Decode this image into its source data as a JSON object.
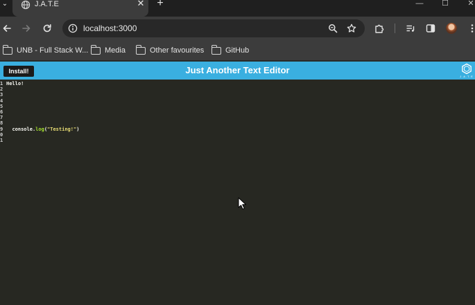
{
  "browser": {
    "tab": {
      "title": "J.A.T.E",
      "close_glyph": "✕"
    },
    "new_tab_glyph": "+",
    "tab_menu_glyph": "⌄",
    "window_controls": [
      "—",
      "☐",
      "✕"
    ],
    "address": {
      "url": "localhost:3000"
    },
    "bookmarks": [
      {
        "label": "UNB - Full Stack W..."
      },
      {
        "label": "Media"
      },
      {
        "label": "Other favourites"
      },
      {
        "label": "GitHub"
      }
    ],
    "icons": {
      "back": "arrow-left-icon",
      "forward": "arrow-right-icon",
      "reload": "reload-icon",
      "info": "info-icon",
      "zoom": "zoom-icon",
      "star": "star-icon",
      "extensions": "puzzle-icon",
      "media": "media-control-icon",
      "side_panel": "side-panel-icon",
      "menu": "kebab-menu-icon"
    }
  },
  "app": {
    "install_label": "Install!",
    "title": "Just Another Text Editor",
    "logo_text": "J.A.T.E",
    "header_color": "#3aafe0"
  },
  "editor": {
    "background": "#272822",
    "line_numbers": [
      "1",
      "2",
      "3",
      "4",
      "5",
      "6",
      "7",
      "8",
      "9",
      "0",
      "1"
    ],
    "lines": [
      {
        "plain": "Hello!"
      },
      {
        "plain": ""
      },
      {
        "plain": ""
      },
      {
        "plain": ""
      },
      {
        "plain": ""
      },
      {
        "plain": ""
      },
      {
        "plain": ""
      },
      {
        "plain": ""
      },
      {
        "indent": "  ",
        "obj": "console.",
        "fn": "log",
        "open": "(",
        "str": "\"Testing!\"",
        "close": ")"
      },
      {
        "plain": ""
      },
      {
        "plain": ""
      }
    ]
  }
}
